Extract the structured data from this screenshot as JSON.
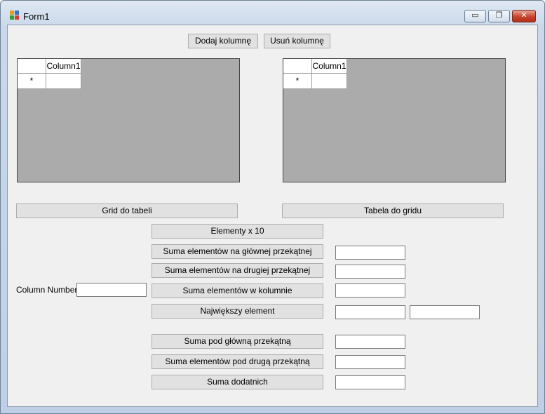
{
  "window": {
    "title": "Form1",
    "minimize_glyph": "▭",
    "maximize_glyph": "❐",
    "close_glyph": "✕",
    "app_icon": "winforms-app-icon"
  },
  "columns_toolbar": {
    "add_column": "Dodaj kolumnę",
    "remove_column": "Usuń kolumnę"
  },
  "grid_left": {
    "column_header": "Column1",
    "new_row_marker": "*"
  },
  "grid_right": {
    "column_header": "Column1",
    "new_row_marker": "*"
  },
  "transfer": {
    "grid_to_table": "Grid do tabeli",
    "table_to_grid": "Tabela do gridu"
  },
  "operations": {
    "elements_x10": "Elementy x 10",
    "main_diagonal_sum": "Suma elementów na głównej przekątnej",
    "second_diagonal_sum": "Suma elementów na drugiej przekątnej",
    "column_sum": "Suma elementów w kolumnie",
    "max_element": "Największy element",
    "below_main_sum": "Suma pod główną przekątną",
    "below_second_sum": "Suma elementów pod drugą przekątną",
    "positive_sum": "Suma dodatnich"
  },
  "column_number": {
    "label": "Column Number",
    "value": ""
  },
  "results": {
    "main_diagonal_sum": "",
    "second_diagonal_sum": "",
    "column_sum": "",
    "max_element_value": "",
    "max_element_position": "",
    "below_main_sum": "",
    "below_second_sum": "",
    "positive_sum": ""
  }
}
